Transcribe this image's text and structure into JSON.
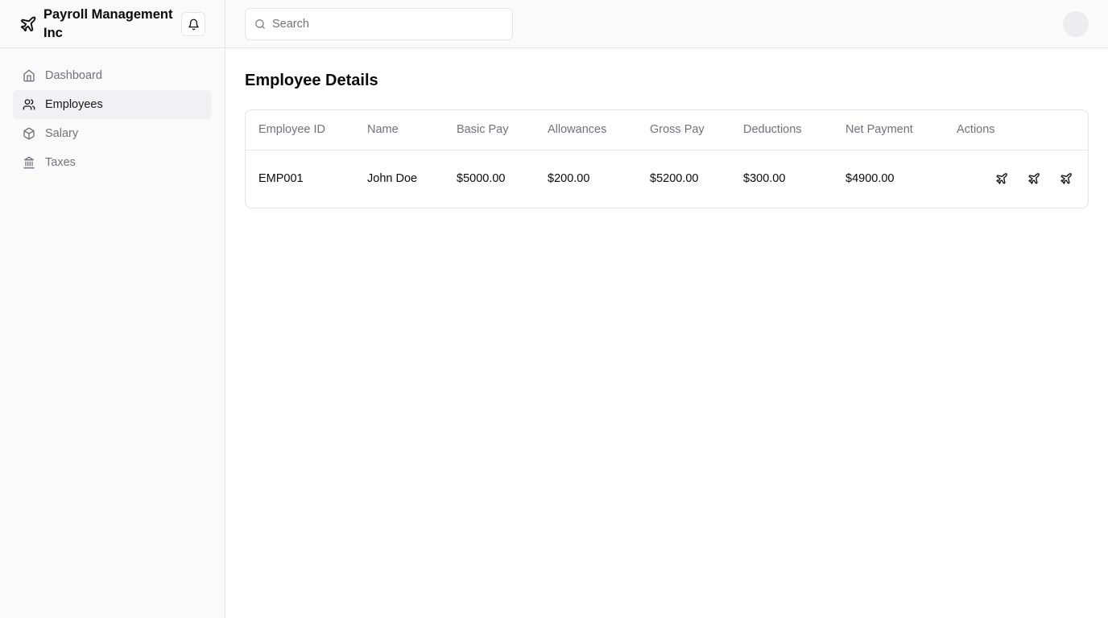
{
  "brand": {
    "name": "Payroll Management Inc",
    "icon": "plane-icon"
  },
  "header": {
    "notification_icon": "bell-icon",
    "search_placeholder": "Search",
    "search_value": ""
  },
  "sidebar": {
    "items": [
      {
        "label": "Dashboard",
        "icon": "home-icon",
        "active": false
      },
      {
        "label": "Employees",
        "icon": "users-icon",
        "active": true
      },
      {
        "label": "Salary",
        "icon": "package-icon",
        "active": false
      },
      {
        "label": "Taxes",
        "icon": "landmark-icon",
        "active": false
      }
    ]
  },
  "main": {
    "title": "Employee Details",
    "table": {
      "columns": [
        "Employee ID",
        "Name",
        "Basic Pay",
        "Allowances",
        "Gross Pay",
        "Deductions",
        "Net Payment",
        "Actions"
      ],
      "rows": [
        {
          "id": "EMP001",
          "name": "John Doe",
          "basic": "$5000.00",
          "allowances": "$200.00",
          "gross": "$5200.00",
          "deductions": "$300.00",
          "net": "$4900.00"
        }
      ],
      "action_icons": [
        "plane-icon",
        "plane-icon",
        "plane-icon"
      ]
    }
  },
  "colors": {
    "text": "#09090b",
    "muted": "#71717a",
    "border": "#e4e4e7",
    "sidebar_bg": "#fafafa",
    "active_bg": "#f1f1f3"
  }
}
